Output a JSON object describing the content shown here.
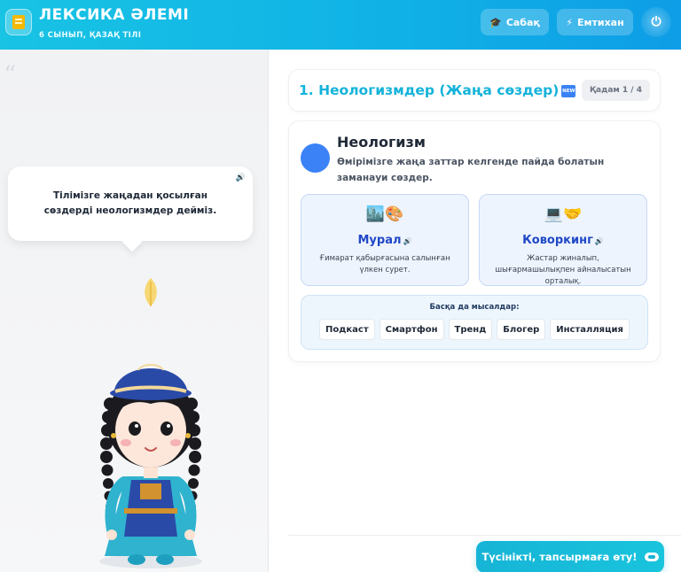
{
  "header": {
    "title": "ЛЕКСИКА ӘЛЕМІ",
    "subtitle": "6 СЫНЫП, ҚАЗАҚ ТІЛІ",
    "lesson_icon": "🎓",
    "lesson_label": "Сабақ",
    "exam_icon": "⚡",
    "exam_label": "Емтихан",
    "power_icon": "⏻"
  },
  "left": {
    "quote_mark": "“",
    "bubble_text": "Тілімізге жаңадан қосылған сөздерді неологизмдер дейміз.",
    "speaker_icon": "🔊"
  },
  "step": {
    "title": "1. Неологизмдер (Жаңа сөздер)",
    "badge": "NEW",
    "counter": "Қадам 1 / 4"
  },
  "term": {
    "title": "Неологизм",
    "definition": "Өмірімізге жаңа заттар келгенде пайда болатын заманауи сөздер."
  },
  "examples": [
    {
      "icons": "🏙️🎨",
      "word": "Мурал",
      "speaker": "🔊",
      "description": "Ғимарат қабырғасына салынған үлкен сурет."
    },
    {
      "icons": "💻🤝",
      "word": "Коворкинг",
      "speaker": "🔊",
      "description": "Жастар жиналып, шығармашылықпен айналысатын орталық."
    }
  ],
  "more": {
    "title": "Басқа да мысалдар:",
    "chips": [
      "Подкаст",
      "Смартфон",
      "Тренд",
      "Блогер",
      "Инсталляция"
    ]
  },
  "cta": {
    "label": "Түсінікті, тапсырмаға өту!"
  },
  "colors": {
    "header_start": "#18c3e4",
    "header_end": "#0e9de6",
    "accent": "#14b3da",
    "term_dot": "#3b82f6",
    "example_word": "#2048c7"
  }
}
